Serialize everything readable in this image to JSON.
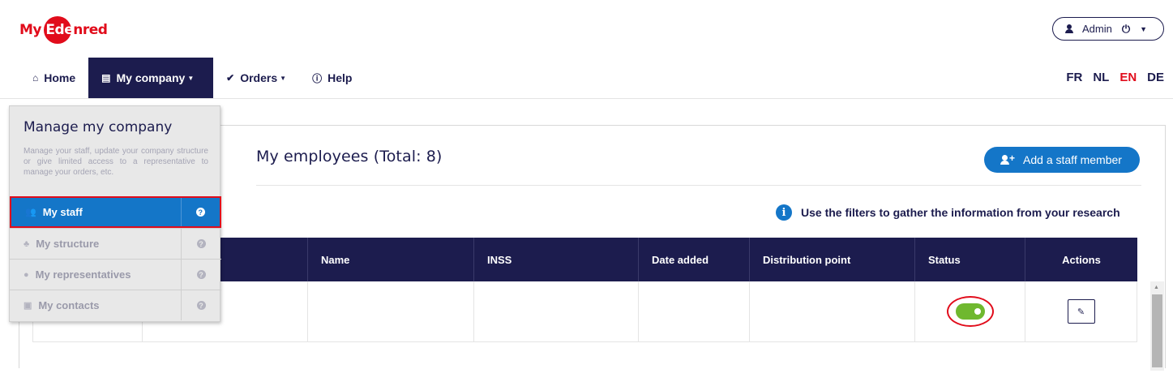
{
  "brand": {
    "logo_prefix": "My",
    "logo_middle": "Ede",
    "logo_suffix": "nred",
    "color": "#e10c1b"
  },
  "user": {
    "label": "Admin"
  },
  "nav": {
    "home": "Home",
    "my_company": "My company",
    "orders": "Orders",
    "help": "Help"
  },
  "languages": [
    {
      "code": "FR",
      "active": false
    },
    {
      "code": "NL",
      "active": false
    },
    {
      "code": "EN",
      "active": true
    },
    {
      "code": "DE",
      "active": false
    }
  ],
  "dropdown": {
    "title": "Manage my company",
    "description": "Manage your staff, update your company structure or give limited access to a representative to manage your orders, etc.",
    "items": [
      {
        "label": "My staff",
        "icon": "users-icon",
        "active": true
      },
      {
        "label": "My structure",
        "icon": "sitemap-icon",
        "active": false
      },
      {
        "label": "My representatives",
        "icon": "representative-icon",
        "active": false
      },
      {
        "label": "My contacts",
        "icon": "contact-card-icon",
        "active": false
      }
    ]
  },
  "main": {
    "title": "My employees (Total: 8)",
    "add_button": "Add a staff member",
    "info_text": "Use the filters to gather the information from your research"
  },
  "table": {
    "columns": [
      "",
      "",
      "Name",
      "INSS",
      "Date added",
      "Distribution point",
      "Status",
      "Actions"
    ],
    "rows": [
      {
        "status": "active"
      }
    ]
  },
  "colors": {
    "navy": "#1c1c4e",
    "blue": "#1476c8",
    "red": "#e10c1b",
    "green": "#6fb82f"
  }
}
